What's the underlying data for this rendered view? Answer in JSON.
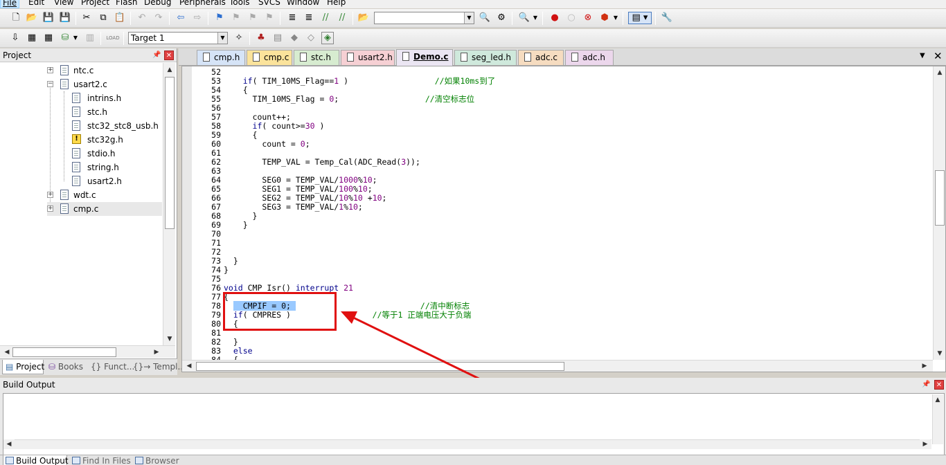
{
  "menu": [
    "File",
    "Edit",
    "View",
    "Project",
    "Flash",
    "Debug",
    "Peripherals",
    "Tools",
    "SVCS",
    "Window",
    "Help"
  ],
  "toolbar": {
    "target_value": "Target 1",
    "search_value": ""
  },
  "project_panel": {
    "title": "Project",
    "tree": [
      {
        "label": "ntc.c",
        "level": 1,
        "expander": "+",
        "icon": "file"
      },
      {
        "label": "usart2.c",
        "level": 1,
        "expander": "-",
        "icon": "file"
      },
      {
        "label": "intrins.h",
        "level": 2,
        "icon": "file"
      },
      {
        "label": "stc.h",
        "level": 2,
        "icon": "file"
      },
      {
        "label": "stc32_stc8_usb.h",
        "level": 2,
        "icon": "file"
      },
      {
        "label": "stc32g.h",
        "level": 2,
        "icon": "warning"
      },
      {
        "label": "stdio.h",
        "level": 2,
        "icon": "file"
      },
      {
        "label": "string.h",
        "level": 2,
        "icon": "file"
      },
      {
        "label": "usart2.h",
        "level": 2,
        "icon": "file"
      },
      {
        "label": "wdt.c",
        "level": 1,
        "expander": "+",
        "icon": "file"
      },
      {
        "label": "cmp.c",
        "level": 1,
        "expander": "+",
        "icon": "file",
        "selected": true
      }
    ],
    "tabs": [
      "Project",
      "Books",
      "{} Funct...",
      "{}→ Templ..."
    ]
  },
  "editor_tabs": [
    {
      "label": "cmp.h",
      "color": "#d6e4f7"
    },
    {
      "label": "cmp.c",
      "color": "#fbe39b"
    },
    {
      "label": "stc.h",
      "color": "#d7ecd0"
    },
    {
      "label": "usart2.h",
      "color": "#f6d0d4"
    },
    {
      "label": "Demo.c",
      "color": "#ebe6f3",
      "active": true
    },
    {
      "label": "seg_led.h",
      "color": "#cfe9dc"
    },
    {
      "label": "adc.c",
      "color": "#f6dcc0"
    },
    {
      "label": "adc.h",
      "color": "#ecd7ec"
    }
  ],
  "code": [
    {
      "n": "52",
      "t": ""
    },
    {
      "n": "53",
      "t": "    if( TIM_10MS_Flag==1 )                  //如果10ms到了"
    },
    {
      "n": "54",
      "t": "    {"
    },
    {
      "n": "55",
      "t": "      TIM_10MS_Flag = 0;                  //清空标志位"
    },
    {
      "n": "56",
      "t": ""
    },
    {
      "n": "57",
      "t": "      count++;"
    },
    {
      "n": "58",
      "t": "      if( count>=30 )"
    },
    {
      "n": "59",
      "t": "      {"
    },
    {
      "n": "60",
      "t": "        count = 0;"
    },
    {
      "n": "61",
      "t": ""
    },
    {
      "n": "62",
      "t": "        TEMP_VAL = Temp_Cal(ADC_Read(3));"
    },
    {
      "n": "63",
      "t": ""
    },
    {
      "n": "64",
      "t": "        SEG0 = TEMP_VAL/1000%10;"
    },
    {
      "n": "65",
      "t": "        SEG1 = TEMP_VAL/100%10;"
    },
    {
      "n": "66",
      "t": "        SEG2 = TEMP_VAL/10%10 +10;"
    },
    {
      "n": "67",
      "t": "        SEG3 = TEMP_VAL/1%10;"
    },
    {
      "n": "68",
      "t": "      }"
    },
    {
      "n": "69",
      "t": "    }"
    },
    {
      "n": "70",
      "t": ""
    },
    {
      "n": "71",
      "t": ""
    },
    {
      "n": "72",
      "t": ""
    },
    {
      "n": "73",
      "t": "  }"
    },
    {
      "n": "74",
      "t": "}"
    },
    {
      "n": "75",
      "t": ""
    },
    {
      "n": "76",
      "t": "void CMP_Isr() interrupt 21"
    },
    {
      "n": "77",
      "t": "{"
    },
    {
      "n": "78",
      "t": "    CMPIF = 0;                          //清中断标志"
    },
    {
      "n": "79",
      "t": "  if( CMPRES )                 //等于1 正端电压大于负端"
    },
    {
      "n": "80",
      "t": "  {"
    },
    {
      "n": "81",
      "t": ""
    },
    {
      "n": "82",
      "t": "  }"
    },
    {
      "n": "83",
      "t": "  else"
    },
    {
      "n": "84",
      "t": "  {"
    }
  ],
  "build_output": {
    "title": "Build Output",
    "tabs": [
      "Build Output",
      "Find In Files",
      "Browser"
    ]
  }
}
